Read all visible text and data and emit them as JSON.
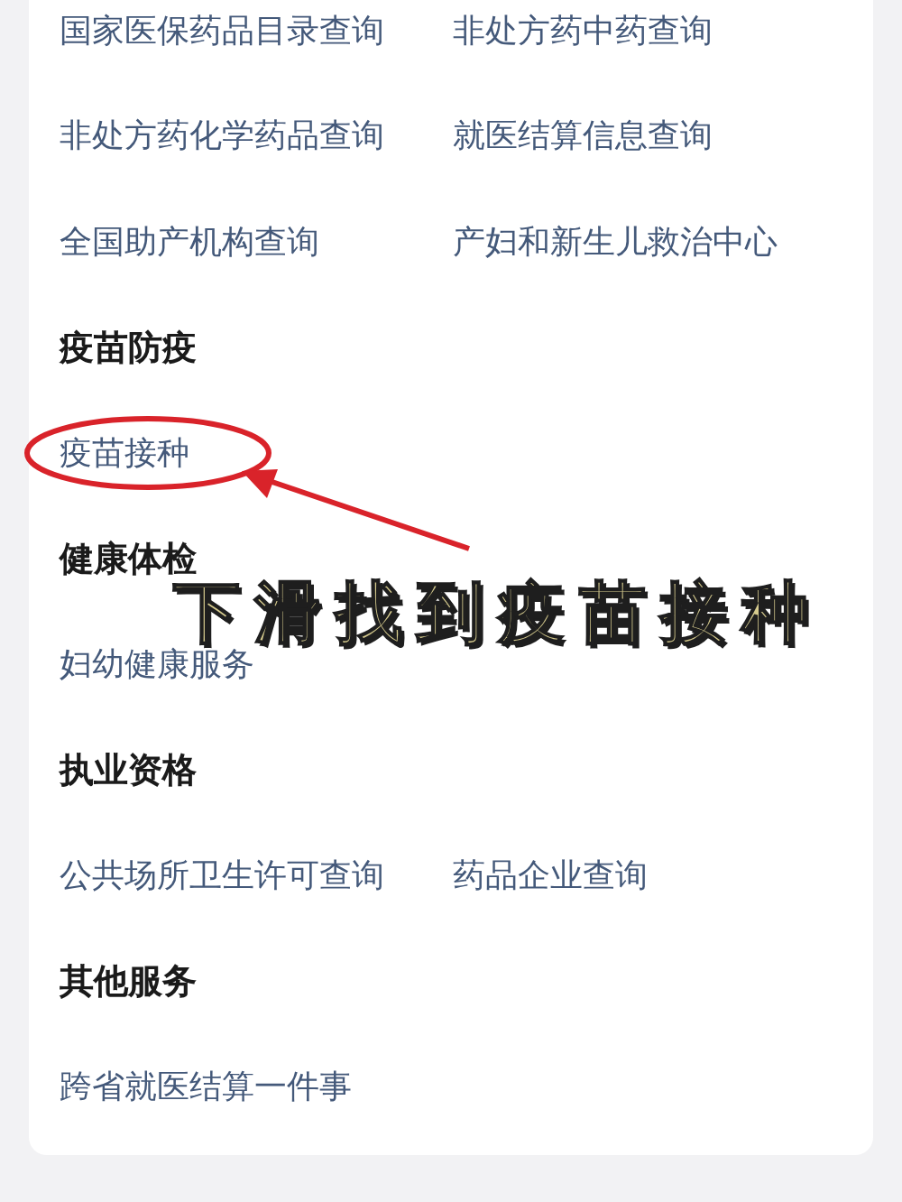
{
  "sections": [
    {
      "items": [
        "国家医保药品目录查询",
        "非处方药中药查询",
        "非处方药化学药品查询",
        "就医结算信息查询",
        "全国助产机构查询",
        "产妇和新生儿救治中心"
      ]
    },
    {
      "title": "疫苗防疫",
      "items": [
        "疫苗接种"
      ]
    },
    {
      "title": "健康体检",
      "items": [
        "妇幼健康服务"
      ]
    },
    {
      "title": "执业资格",
      "items": [
        "公共场所卫生许可查询",
        "药品企业查询"
      ]
    },
    {
      "title": "其他服务",
      "items": [
        "跨省就医结算一件事"
      ]
    }
  ],
  "annotation": {
    "caption": "下滑找到疫苗接种"
  }
}
